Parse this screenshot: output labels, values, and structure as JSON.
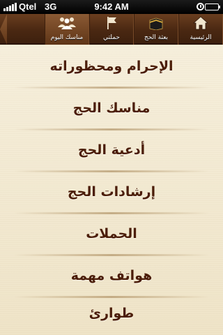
{
  "status_bar": {
    "carrier": "Qtel",
    "network": "3G",
    "time": "9:42 AM"
  },
  "toolbar": {
    "tabs": [
      {
        "label": "الرئيسية",
        "icon": "home-icon",
        "active": false
      },
      {
        "label": "بعثة الحج",
        "icon": "kaaba-icon",
        "active": false
      },
      {
        "label": "حملتي",
        "icon": "flag-icon",
        "active": false
      },
      {
        "label": "مناسك اليوم",
        "icon": "people-icon",
        "active": true
      }
    ]
  },
  "menu": {
    "items": [
      {
        "label": "الإحرام ومحظوراته"
      },
      {
        "label": "مناسك الحج"
      },
      {
        "label": "أدعية الحج"
      },
      {
        "label": "إرشادات الحج"
      },
      {
        "label": "الحملات"
      },
      {
        "label": "هواتف مهمة"
      },
      {
        "label": "طوارئ"
      }
    ]
  },
  "colors": {
    "toolbar": "#4a2812",
    "background": "#f4ecd6",
    "menu_text": "#4b1d08"
  }
}
